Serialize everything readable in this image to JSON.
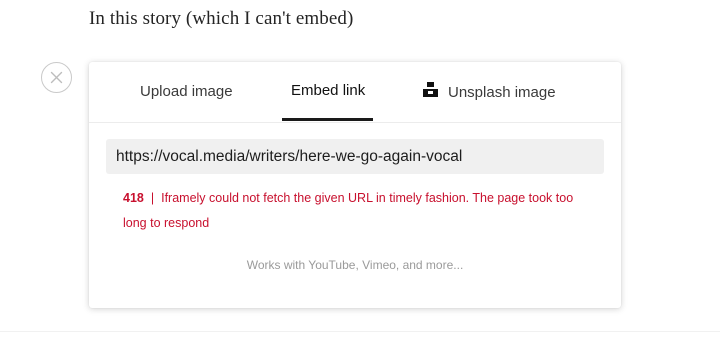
{
  "story": {
    "text": "In this story (which I can't embed)"
  },
  "close_button": {
    "icon": "close-icon"
  },
  "embed_dialog": {
    "tabs": [
      {
        "label": "Upload image",
        "active": false
      },
      {
        "label": "Embed link",
        "active": true
      },
      {
        "label": "Unsplash image",
        "active": false,
        "icon": "unsplash-icon"
      }
    ],
    "url_input": {
      "value": "https://vocal.media/writers/here-we-go-again-vocal"
    },
    "error": {
      "code": "418",
      "separator": "|",
      "message": "Iframely could not fetch the given URL in timely fashion. The page took too long to respond"
    },
    "hint": "Works with YouTube, Vimeo, and more..."
  },
  "colors": {
    "error": "#c8102e",
    "hint": "#9a9a9a",
    "input_bg": "#f0f0f0",
    "active_tab_underline": "#1a1a1a"
  }
}
